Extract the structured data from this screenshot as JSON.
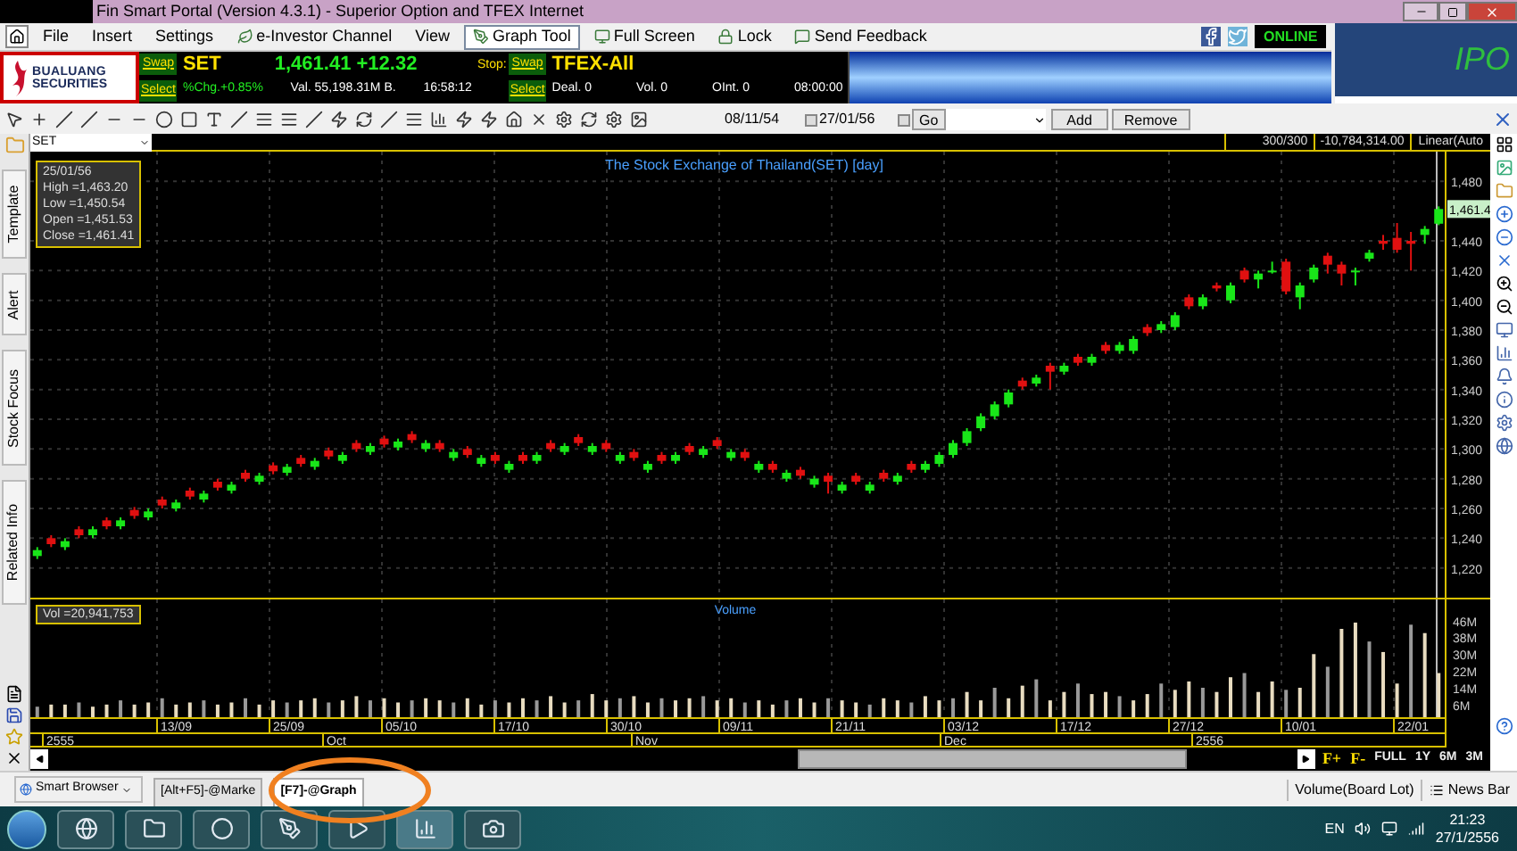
{
  "window": {
    "title": "Fin Smart Portal (Version 4.3.1) - Superior Option and TFEX Internet"
  },
  "menu": [
    {
      "label": "File",
      "selected": false
    },
    {
      "label": "Insert",
      "selected": false
    },
    {
      "label": "Settings",
      "selected": false
    },
    {
      "label": "e-Investor Channel",
      "selected": false
    },
    {
      "label": "View",
      "selected": false
    },
    {
      "label": "Graph Tool",
      "selected": true
    },
    {
      "label": "Full Screen",
      "selected": false
    },
    {
      "label": "Lock",
      "selected": false
    },
    {
      "label": "Send Feedback",
      "selected": false
    }
  ],
  "online_badge": "ONLINE",
  "ipo_banner": "IPO",
  "logo": {
    "line1": "BUALUANG",
    "line2": "SECURITIES"
  },
  "ticker": {
    "swap": "Swap",
    "select": "Select",
    "symbol": "SET",
    "price": "1,461.41 +12.32",
    "stop": "Stop:",
    "pct_change": "%Chg.+0.85%",
    "value": "Val. 55,198.31M B.",
    "time": "16:58:12"
  },
  "tfex": {
    "swap": "Swap",
    "select": "Select",
    "symbol": "TFEX-All",
    "deal": "Deal. 0",
    "vol": "Vol. 0",
    "oint": "OInt. 0",
    "time": "08:00:00"
  },
  "toolbar": {
    "date_from": {
      "value": "08/11/54",
      "checked": false
    },
    "date_to": {
      "value": "27/01/56",
      "checked": false
    },
    "go": "Go",
    "add": "Add",
    "remove": "Remove"
  },
  "side_tabs": [
    {
      "label": "Template"
    },
    {
      "label": "Alert"
    },
    {
      "label": "Stock Focus"
    },
    {
      "label": "Related Info"
    }
  ],
  "chart": {
    "symbol": "SET",
    "count": "300/300",
    "reading": "-10,784,314.00",
    "scale": "Linear(Auto",
    "title": "The Stock Exchange of Thailand(SET) [day]",
    "info": [
      "25/01/56",
      "High =1,463.20",
      "Low =1,450.54",
      "Open =1,451.53",
      "Close =1,461.41"
    ],
    "last_price": "1,461.4",
    "chart_data": {
      "type": "candlestick",
      "grid": true,
      "ylim": [
        1200,
        1500
      ],
      "yticks": [
        {
          "value": 1480,
          "label": "1,480"
        },
        {
          "value": 1440,
          "label": "1,440"
        },
        {
          "value": 1420,
          "label": "1,420"
        },
        {
          "value": 1400,
          "label": "1,400"
        },
        {
          "value": 1380,
          "label": "1,380"
        },
        {
          "value": 1360,
          "label": "1,360"
        },
        {
          "value": 1340,
          "label": "1,340"
        },
        {
          "value": 1320,
          "label": "1,320"
        },
        {
          "value": 1300,
          "label": "1,300"
        },
        {
          "value": 1280,
          "label": "1,280"
        },
        {
          "value": 1260,
          "label": "1,260"
        },
        {
          "value": 1240,
          "label": "1,240"
        },
        {
          "value": 1220,
          "label": "1,220"
        }
      ],
      "ohlc": [
        [
          1228,
          1234,
          1226,
          1232
        ],
        [
          1240,
          1242,
          1234,
          1236
        ],
        [
          1234,
          1240,
          1232,
          1238
        ],
        [
          1246,
          1248,
          1240,
          1242
        ],
        [
          1242,
          1248,
          1240,
          1246
        ],
        [
          1252,
          1254,
          1246,
          1248
        ],
        [
          1248,
          1254,
          1246,
          1252
        ],
        [
          1259,
          1261,
          1253,
          1255
        ],
        [
          1254,
          1260,
          1252,
          1258
        ],
        [
          1266,
          1268,
          1260,
          1262
        ],
        [
          1260,
          1266,
          1258,
          1264
        ],
        [
          1272,
          1274,
          1266,
          1268
        ],
        [
          1266,
          1272,
          1264,
          1270
        ],
        [
          1278,
          1280,
          1272,
          1274
        ],
        [
          1272,
          1278,
          1270,
          1276
        ],
        [
          1284,
          1286,
          1278,
          1280
        ],
        [
          1278,
          1284,
          1276,
          1282
        ],
        [
          1289,
          1291,
          1283,
          1285
        ],
        [
          1284,
          1290,
          1282,
          1288
        ],
        [
          1294,
          1296,
          1288,
          1290
        ],
        [
          1288,
          1294,
          1286,
          1292
        ],
        [
          1299,
          1301,
          1293,
          1295
        ],
        [
          1292,
          1298,
          1290,
          1296
        ],
        [
          1304,
          1306,
          1298,
          1300
        ],
        [
          1298,
          1304,
          1296,
          1302
        ],
        [
          1307,
          1309,
          1301,
          1303
        ],
        [
          1301,
          1307,
          1299,
          1305
        ],
        [
          1310,
          1312,
          1304,
          1306
        ],
        [
          1300,
          1306,
          1298,
          1304
        ],
        [
          1304,
          1306,
          1298,
          1300
        ],
        [
          1294,
          1300,
          1292,
          1298
        ],
        [
          1300,
          1302,
          1294,
          1296
        ],
        [
          1290,
          1296,
          1288,
          1294
        ],
        [
          1296,
          1298,
          1290,
          1292
        ],
        [
          1286,
          1292,
          1284,
          1290
        ],
        [
          1296,
          1298,
          1290,
          1292
        ],
        [
          1292,
          1298,
          1290,
          1296
        ],
        [
          1304,
          1306,
          1298,
          1300
        ],
        [
          1298,
          1304,
          1296,
          1302
        ],
        [
          1308,
          1310,
          1302,
          1304
        ],
        [
          1298,
          1304,
          1296,
          1302
        ],
        [
          1304,
          1306,
          1298,
          1300
        ],
        [
          1292,
          1298,
          1290,
          1296
        ],
        [
          1298,
          1300,
          1292,
          1294
        ],
        [
          1286,
          1292,
          1284,
          1290
        ],
        [
          1296,
          1298,
          1290,
          1292
        ],
        [
          1292,
          1298,
          1290,
          1296
        ],
        [
          1302,
          1304,
          1296,
          1298
        ],
        [
          1296,
          1302,
          1294,
          1300
        ],
        [
          1306,
          1308,
          1300,
          1302
        ],
        [
          1294,
          1300,
          1292,
          1298
        ],
        [
          1298,
          1300,
          1292,
          1294
        ],
        [
          1286,
          1292,
          1284,
          1290
        ],
        [
          1290,
          1292,
          1284,
          1286
        ],
        [
          1280,
          1286,
          1278,
          1284
        ],
        [
          1286,
          1288,
          1280,
          1282
        ],
        [
          1276,
          1282,
          1274,
          1280
        ],
        [
          1282,
          1284,
          1270,
          1278
        ],
        [
          1272,
          1278,
          1270,
          1276
        ],
        [
          1282,
          1284,
          1276,
          1278
        ],
        [
          1272,
          1278,
          1270,
          1276
        ],
        [
          1284,
          1286,
          1278,
          1280
        ],
        [
          1278,
          1284,
          1276,
          1282
        ],
        [
          1290,
          1292,
          1284,
          1286
        ],
        [
          1286,
          1292,
          1284,
          1290
        ],
        [
          1290,
          1298,
          1288,
          1296
        ],
        [
          1296,
          1306,
          1294,
          1304
        ],
        [
          1304,
          1314,
          1302,
          1312
        ],
        [
          1314,
          1324,
          1312,
          1322
        ],
        [
          1322,
          1332,
          1320,
          1330
        ],
        [
          1330,
          1340,
          1328,
          1338
        ],
        [
          1346,
          1348,
          1340,
          1342
        ],
        [
          1344,
          1350,
          1342,
          1348
        ],
        [
          1356,
          1358,
          1340,
          1352
        ],
        [
          1352,
          1358,
          1350,
          1356
        ],
        [
          1362,
          1364,
          1356,
          1358
        ],
        [
          1358,
          1364,
          1356,
          1362
        ],
        [
          1370,
          1372,
          1364,
          1366
        ],
        [
          1366,
          1372,
          1364,
          1370
        ],
        [
          1366,
          1376,
          1364,
          1374
        ],
        [
          1382,
          1384,
          1376,
          1378
        ],
        [
          1380,
          1386,
          1378,
          1384
        ],
        [
          1382,
          1392,
          1380,
          1390
        ],
        [
          1402,
          1404,
          1394,
          1396
        ],
        [
          1396,
          1404,
          1394,
          1402
        ],
        [
          1410,
          1412,
          1406,
          1408
        ],
        [
          1400,
          1412,
          1398,
          1410
        ],
        [
          1420,
          1422,
          1412,
          1414
        ],
        [
          1414,
          1420,
          1408,
          1418
        ],
        [
          1420,
          1426,
          1418,
          1420
        ],
        [
          1426,
          1428,
          1404,
          1406
        ],
        [
          1402,
          1412,
          1394,
          1410
        ],
        [
          1414,
          1424,
          1412,
          1422
        ],
        [
          1430,
          1432,
          1418,
          1424
        ],
        [
          1424,
          1426,
          1410,
          1418
        ],
        [
          1420,
          1422,
          1410,
          1420
        ],
        [
          1428,
          1434,
          1426,
          1432
        ],
        [
          1440,
          1444,
          1434,
          1438
        ],
        [
          1442,
          1452,
          1432,
          1434
        ],
        [
          1440,
          1446,
          1420,
          1438
        ],
        [
          1444,
          1450,
          1438,
          1448
        ],
        [
          1451.53,
          1463.2,
          1450.54,
          1461.41
        ]
      ]
    },
    "volume": {
      "label": "Vol =20,941,753",
      "title": "Volume",
      "chart_data": {
        "type": "bar",
        "grid": true,
        "ylim": [
          0,
          56
        ],
        "yticks": [
          {
            "value": 46,
            "label": "46M"
          },
          {
            "value": 38,
            "label": "38M"
          },
          {
            "value": 30,
            "label": "30M"
          },
          {
            "value": 22,
            "label": "22M"
          },
          {
            "value": 14,
            "label": "14M"
          },
          {
            "value": 6,
            "label": "6M"
          }
        ],
        "values": [
          5,
          6,
          6,
          7,
          5,
          6,
          8,
          6,
          7,
          9,
          6,
          7,
          8,
          6,
          7,
          9,
          6,
          8,
          7,
          8,
          9,
          7,
          8,
          10,
          8,
          9,
          7,
          8,
          9,
          8,
          7,
          9,
          6,
          8,
          7,
          9,
          8,
          10,
          7,
          8,
          11,
          8,
          9,
          10,
          7,
          9,
          8,
          9,
          10,
          8,
          9,
          7,
          8,
          6,
          8,
          9,
          7,
          9,
          8,
          7,
          6,
          9,
          8,
          7,
          10,
          8,
          9,
          12,
          8,
          14,
          9,
          15,
          18,
          8,
          12,
          16,
          11,
          12,
          10,
          8,
          11,
          16,
          13,
          17,
          14,
          12,
          19,
          21,
          12,
          17,
          13,
          14,
          30,
          24,
          42,
          45,
          36,
          31,
          16,
          44,
          40,
          21
        ]
      }
    },
    "dates": [
      "13/09",
      "25/09",
      "05/10",
      "17/10",
      "30/10",
      "09/11",
      "21/11",
      "03/12",
      "17/12",
      "27/12",
      "10/01",
      "22/01"
    ],
    "periods": [
      "2555",
      "Oct",
      "Nov",
      "Dec",
      "2556"
    ],
    "zoom": [
      "F+",
      "F-",
      "FULL",
      "1Y",
      "6M",
      "3M"
    ]
  },
  "browser_tab": "Smart Browser",
  "doc_tabs": [
    {
      "label": "[Alt+F5]-@Marke",
      "selected": false
    },
    {
      "label": "[F7]-@Graph",
      "selected": true
    }
  ],
  "status": [
    "Volume(Board Lot)",
    "News Bar"
  ],
  "taskbar": {
    "lang": "EN",
    "time": "21:23",
    "date": "27/1/2556"
  }
}
